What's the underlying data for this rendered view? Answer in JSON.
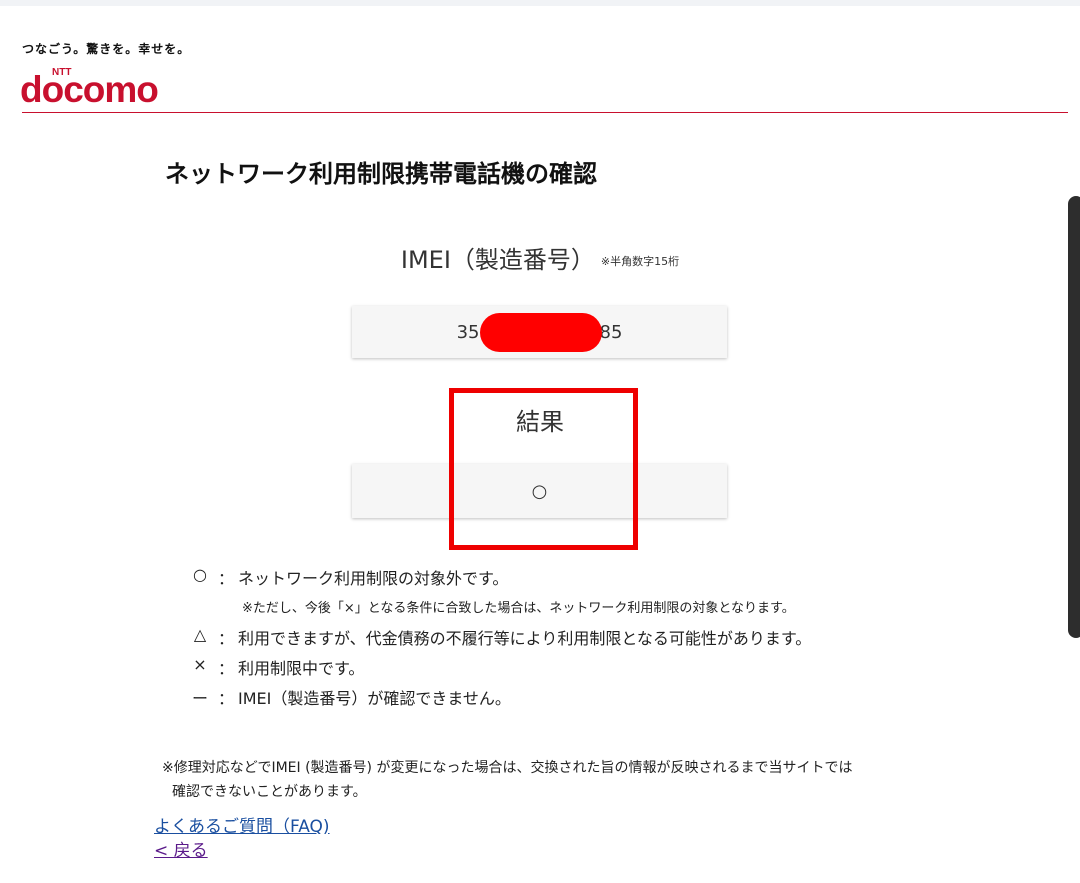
{
  "header": {
    "tagline": "つなごう。驚きを。幸せを。",
    "logo_small": "NTT",
    "logo_text": "docomo",
    "brand_color": "#c8102e"
  },
  "page": {
    "title": "ネットワーク利用制限携帯電話機の確認"
  },
  "imei": {
    "label": "IMEI（製造番号）",
    "hint": "※半角数字15桁",
    "value_prefix": "35",
    "value_suffix": "85"
  },
  "result": {
    "label": "結果",
    "value": "○",
    "highlight_color": "#ee0000"
  },
  "legend": {
    "items": [
      {
        "symbol": "○",
        "colon": "：",
        "text": "ネットワーク利用制限の対象外です。"
      },
      {
        "note": "※ただし、今後「×」となる条件に合致した場合は、ネットワーク利用制限の対象となります。"
      },
      {
        "symbol": "△",
        "colon": "：",
        "text": "利用できますが、代金債務の不履行等により利用制限となる可能性があります。"
      },
      {
        "symbol": "×",
        "colon": "：",
        "text": "利用制限中です。"
      },
      {
        "symbol": "ー",
        "colon": "：",
        "text": "IMEI（製造番号）が確認できません。"
      }
    ]
  },
  "footnote": {
    "line1": "※修理対応などでIMEI (製造番号) が変更になった場合は、交換された旨の情報が反映されるまで当サイトでは",
    "line2": "確認できないことがあります。"
  },
  "links": {
    "faq": "よくあるご質問（FAQ)",
    "back": "< 戻る"
  }
}
